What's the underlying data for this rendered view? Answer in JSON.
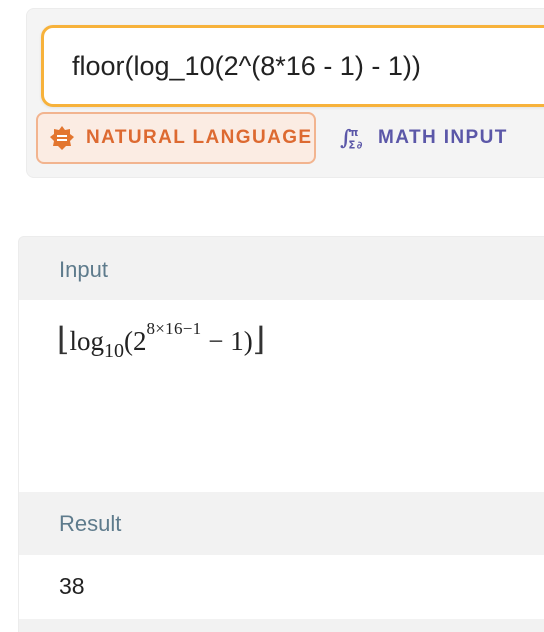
{
  "query": {
    "value": "floor(log_10(2^(8*16 - 1) - 1))"
  },
  "modes": {
    "natural_language": {
      "label": "NATURAL LANGUAGE",
      "icon": "natural-language-icon",
      "selected": true,
      "color": "#dd6a31"
    },
    "math_input": {
      "label": "MATH INPUT",
      "icon": "math-input-icon",
      "selected": false,
      "color": "#5b57a8"
    }
  },
  "input_pod": {
    "title": "Input",
    "expression": {
      "floor_open": "⌊",
      "log": "log",
      "base": "10",
      "open_paren": "(",
      "two": "2",
      "exponent": "8×16−1",
      "minus_one": " − 1)",
      "floor_close": "⌋"
    }
  },
  "result_pod": {
    "title": "Result",
    "value": "38"
  },
  "colors": {
    "accent_border": "#f7b23b",
    "pod_header_text": "#5e7b8c"
  }
}
